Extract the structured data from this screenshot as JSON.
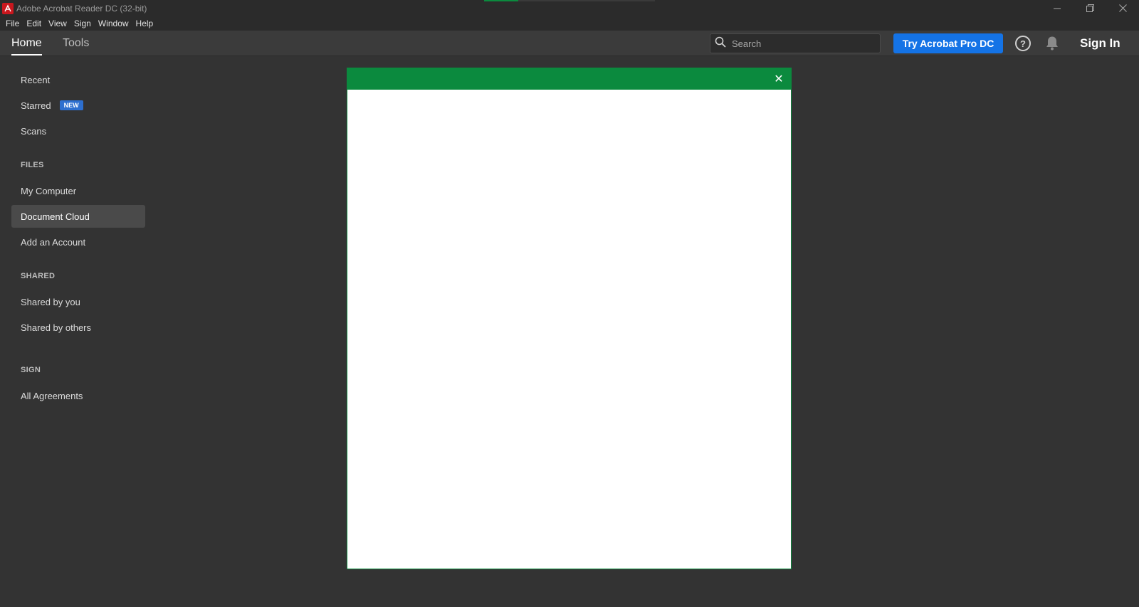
{
  "window": {
    "title": "Adobe Acrobat Reader DC (32-bit)",
    "minimize_icon": "minimize-icon",
    "restore_icon": "restore-icon",
    "close_icon": "close-icon"
  },
  "menu": [
    "File",
    "Edit",
    "View",
    "Sign",
    "Window",
    "Help"
  ],
  "appbar": {
    "tabs": [
      "Home",
      "Tools"
    ],
    "active_tab": "Home",
    "search_placeholder": "Search",
    "try_button": "Try Acrobat Pro DC",
    "sign_in": "Sign In"
  },
  "sidebar": {
    "recent": "Recent",
    "starred": "Starred",
    "starred_badge": "NEW",
    "scans": "Scans",
    "files_heading": "FILES",
    "my_computer": "My Computer",
    "document_cloud": "Document Cloud",
    "add_account": "Add an Account",
    "shared_heading": "SHARED",
    "shared_by_you": "Shared by you",
    "shared_by_others": "Shared by others",
    "sign_heading": "SIGN",
    "all_agreements": "All Agreements",
    "selected": "Document Cloud"
  },
  "dialog": {
    "close_symbol": "✕"
  },
  "colors": {
    "background": "#333333",
    "accent_green": "#0b8a3e",
    "button_blue": "#1473e6",
    "badge_blue": "#2d6fcf",
    "logo_red": "#c9171e"
  }
}
